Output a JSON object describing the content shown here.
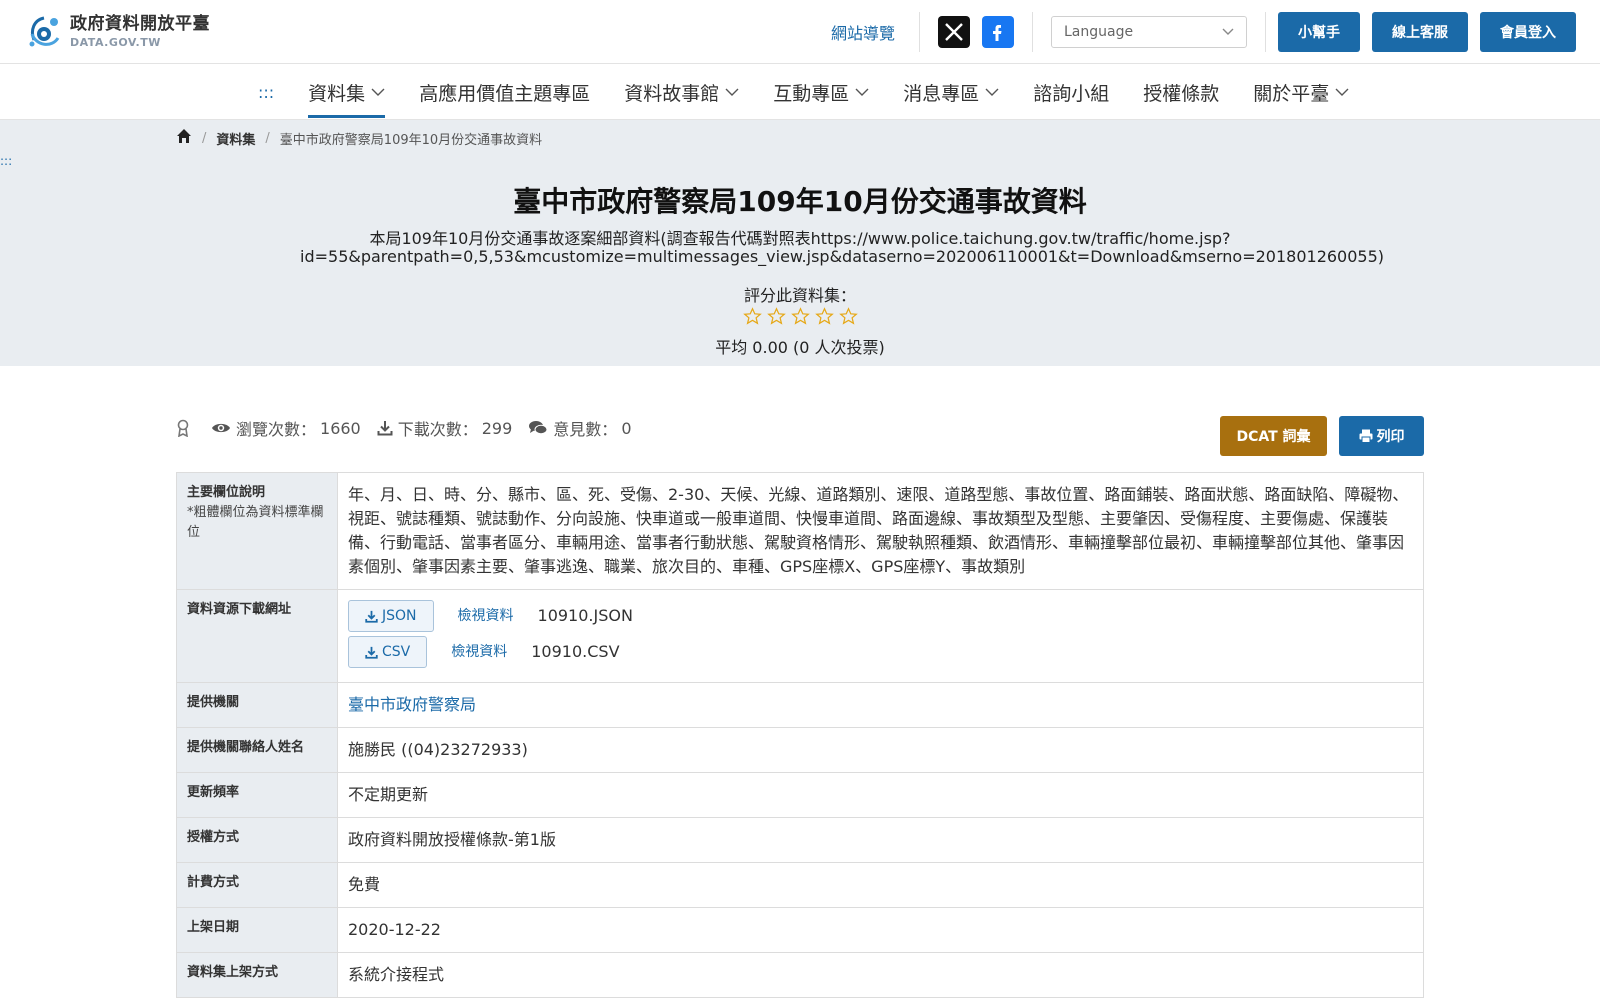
{
  "header": {
    "logo_title": "政府資料開放平臺",
    "logo_sub": "DATA.GOV.TW",
    "sitemap": "網站導覽",
    "language_placeholder": "Language",
    "buttons": [
      "小幫手",
      "線上客服",
      "會員登入"
    ]
  },
  "nav": {
    "dots": ":::",
    "items": [
      {
        "label": "資料集",
        "dropdown": true,
        "active": true
      },
      {
        "label": "高應用價值主題專區",
        "dropdown": false
      },
      {
        "label": "資料故事館",
        "dropdown": true
      },
      {
        "label": "互動專區",
        "dropdown": true
      },
      {
        "label": "消息專區",
        "dropdown": true
      },
      {
        "label": "諮詢小組",
        "dropdown": false
      },
      {
        "label": "授權條款",
        "dropdown": false
      },
      {
        "label": "關於平臺",
        "dropdown": true
      }
    ]
  },
  "breadcrumb": {
    "items": [
      "資料集",
      "臺中市政府警察局109年10月份交通事故資料"
    ]
  },
  "side_dots": ":::",
  "hero": {
    "title": "臺中市政府警察局109年10月份交通事故資料",
    "description": "本局109年10月份交通事故逐案細部資料(調查報告代碼對照表https://www.police.taichung.gov.tw/traffic/home.jsp?id=55&parentpath=0,5,53&mcustomize=multimessages_view.jsp&dataserno=202006110001&t=Download&mserno=201801260055)",
    "rate_label": "評分此資料集：",
    "rating": 0,
    "avg": "平均 0.00 (0 人次投票)"
  },
  "stats": {
    "views_label": "瀏覽次數：",
    "views": "1660",
    "downloads_label": "下載次數：",
    "downloads": "299",
    "comments_label": "意見數：",
    "comments": "0"
  },
  "actions": {
    "dcat": "DCAT 詞彙",
    "print": "列印"
  },
  "meta": {
    "fields_label": "主要欄位說明",
    "fields_note": "*粗體欄位為資料標準欄位",
    "fields_value": "年、月、日、時、分、縣市、區、死、受傷、2-30、天候、光線、道路類別、速限、道路型態、事故位置、路面鋪裝、路面狀態、路面缺陷、障礙物、視距、號誌種類、號誌動作、分向設施、快車道或一般車道間、快慢車道間、路面邊線、事故類型及型態、主要肇因、受傷程度、主要傷處、保護裝備、行動電話、當事者區分、車輛用途、當事者行動狀態、駕駛資格情形、駕駛執照種類、飲酒情形、車輛撞擊部位最初、車輛撞擊部位其他、肇事因素個別、肇事因素主要、肇事逃逸、職業、旅次目的、車種、GPS座標X、GPS座標Y、事故類別",
    "resources_label": "資料資源下載網址",
    "resources": [
      {
        "format": "JSON",
        "view": "檢視資料",
        "name": "10910.JSON"
      },
      {
        "format": "CSV",
        "view": "檢視資料",
        "name": "10910.CSV"
      }
    ],
    "rows": [
      {
        "label": "提供機關",
        "value": "臺中市政府警察局",
        "link": true
      },
      {
        "label": "提供機關聯絡人姓名",
        "value": "施勝民 ((04)23272933)",
        "link": false
      },
      {
        "label": "更新頻率",
        "value": "不定期更新",
        "link": false
      },
      {
        "label": "授權方式",
        "value": "政府資料開放授權條款-第1版",
        "link": false
      },
      {
        "label": "計費方式",
        "value": "免費",
        "link": false
      },
      {
        "label": "上架日期",
        "value": "2020-12-22",
        "link": false
      },
      {
        "label": "資料集上架方式",
        "value": "系統介接程式",
        "link": false
      }
    ]
  },
  "colors": {
    "primary": "#1b6aa8",
    "dcat": "#a8700f",
    "hero_bg": "#e9edf1",
    "star": "#e6a817"
  }
}
